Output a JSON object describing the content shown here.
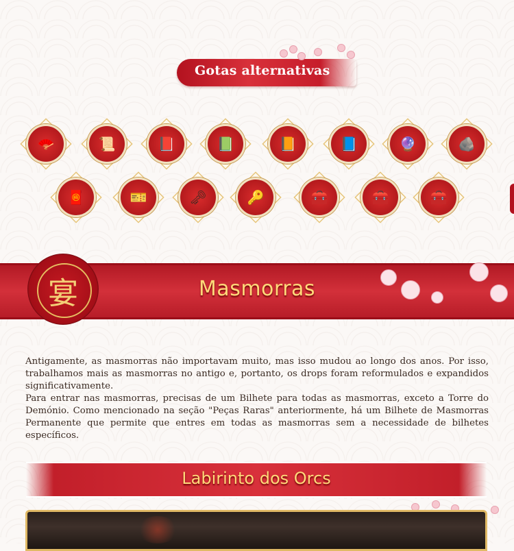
{
  "header": {
    "title": "Gotas alternativas"
  },
  "drops": [
    {
      "icon": "fan-icon",
      "glyph": "🪭"
    },
    {
      "icon": "scroll-bundle-icon",
      "glyph": "📜"
    },
    {
      "icon": "book-icon",
      "glyph": "📕"
    },
    {
      "icon": "green-book-icon",
      "glyph": "📗"
    },
    {
      "icon": "book-icon",
      "glyph": "📙"
    },
    {
      "icon": "green-book-icon",
      "glyph": "📘"
    },
    {
      "icon": "purple-orb-icon",
      "glyph": "🔮"
    },
    {
      "icon": "ore-stones-icon",
      "glyph": "🪨"
    },
    {
      "icon": "red-scroll-icon",
      "glyph": "🧧"
    },
    {
      "icon": "ticket-pouch-icon",
      "glyph": "🎫"
    },
    {
      "icon": "silver-key-icon",
      "glyph": "🗝"
    },
    {
      "icon": "gold-key-icon",
      "glyph": "🔑"
    },
    {
      "icon": "chest-icon",
      "glyph": "🧰"
    },
    {
      "icon": "golden-chest-icon",
      "glyph": "🧰"
    },
    {
      "icon": "silver-chest-icon",
      "glyph": "🧰"
    }
  ],
  "section": {
    "title": "Masmorras",
    "seal_char": "宴",
    "paragraph1": "Antigamente, as masmorras não importavam muito, mas isso mudou ao longo dos anos. Por isso, trabalhamos mais as masmorras no antigo e, portanto, os drops foram reformulados e expandidos significativamente.",
    "paragraph2": "Para entrar nas masmorras, precisas de um Bilhete para todas as masmorras, exceto a Torre do Demónio. Como mencionado na seção \"Peças Raras\" anteriormente, há um Bilhete de Masmorras Permanente que permite que entres em todas as masmorras sem a necessidade de bilhetes específicos."
  },
  "subsection": {
    "title": "Labirinto dos Orcs"
  },
  "colors": {
    "accent_red": "#c61d2a",
    "gold": "#ffd97a",
    "border_gold": "#e0b965"
  }
}
